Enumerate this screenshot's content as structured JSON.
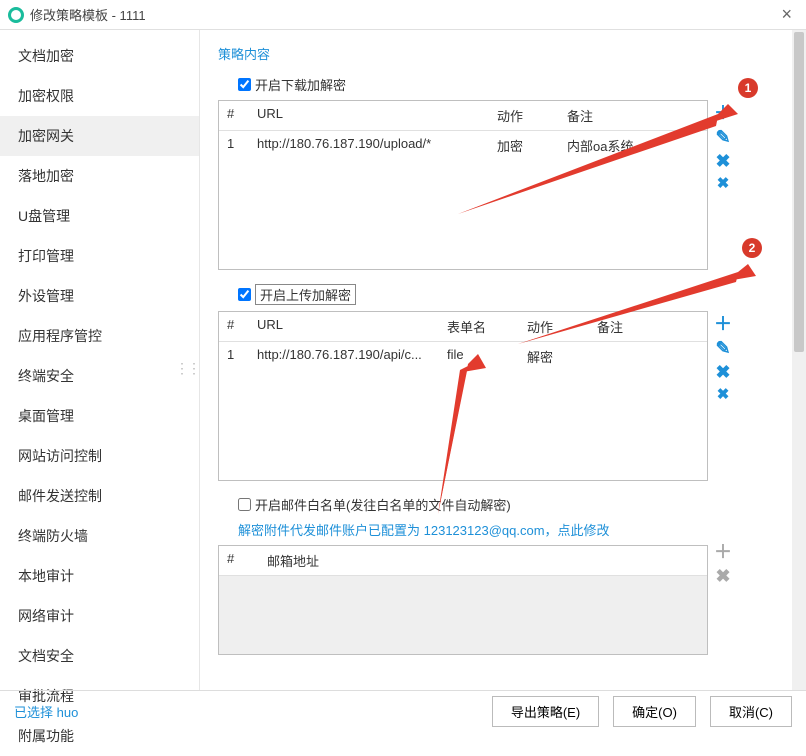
{
  "window": {
    "title": "修改策略模板 - 1111",
    "close": "×"
  },
  "sidebar": {
    "items": [
      {
        "label": "文档加密"
      },
      {
        "label": "加密权限"
      },
      {
        "label": "加密网关",
        "active": true
      },
      {
        "label": "落地加密"
      },
      {
        "label": "U盘管理"
      },
      {
        "label": "打印管理"
      },
      {
        "label": "外设管理"
      },
      {
        "label": "应用程序管控"
      },
      {
        "label": "终端安全"
      },
      {
        "label": "桌面管理"
      },
      {
        "label": "网站访问控制"
      },
      {
        "label": "邮件发送控制"
      },
      {
        "label": "终端防火墙"
      },
      {
        "label": "本地审计"
      },
      {
        "label": "网络审计"
      },
      {
        "label": "文档安全"
      },
      {
        "label": "审批流程"
      },
      {
        "label": "附属功能"
      }
    ]
  },
  "content": {
    "heading": "策略内容",
    "block1": {
      "checkbox_label": "开启下载加解密",
      "headers": {
        "idx": "#",
        "url": "URL",
        "action": "动作",
        "note": "备注"
      },
      "row": {
        "idx": "1",
        "url": "http://180.76.187.190/upload/*",
        "action": "加密",
        "note": "内部oa系统"
      }
    },
    "block2": {
      "checkbox_label": "开启上传加解密",
      "headers": {
        "idx": "#",
        "url": "URL",
        "form": "表单名",
        "action": "动作",
        "note": "备注"
      },
      "row": {
        "idx": "1",
        "url": "http://180.76.187.190/api/c...",
        "form": "file",
        "action": "解密",
        "note": ""
      }
    },
    "block3": {
      "checkbox_label": "开启邮件白名单(发往白名单的文件自动解密)",
      "info_prefix": "解密附件代发邮件账户已配置为 ",
      "info_email": "123123123@qq.com",
      "info_suffix": "，点此修改",
      "headers": {
        "idx": "#",
        "email": "邮箱地址"
      }
    },
    "callouts": {
      "c1": "1",
      "c2": "2"
    }
  },
  "footer": {
    "status": "已选择 huo",
    "export": "导出策略(E)",
    "ok": "确定(O)",
    "cancel": "取消(C)"
  }
}
